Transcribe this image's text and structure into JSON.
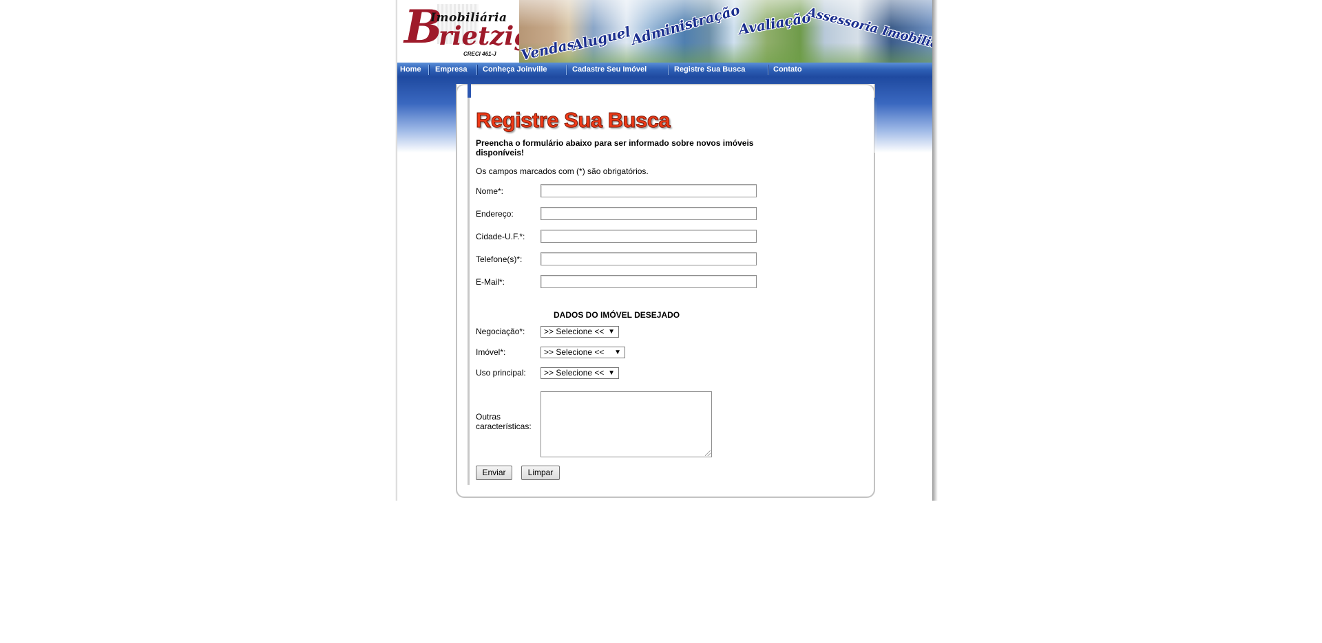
{
  "header": {
    "logo": {
      "letter": "B",
      "brand_top": "Imobiliária",
      "brand_name": "rietzig",
      "creci": "CRECI 461-J"
    },
    "banner_words": [
      "Vendas",
      "Aluguel",
      "Administração",
      "Avaliação",
      "Assessoria Imobiliária"
    ]
  },
  "nav": {
    "items": [
      {
        "label": "Home"
      },
      {
        "label": "Empresa"
      },
      {
        "label": "Conheça Joinville"
      },
      {
        "label": "Cadastre Seu Imóvel"
      },
      {
        "label": "Registre Sua Busca"
      },
      {
        "label": "Contato"
      }
    ]
  },
  "form": {
    "title": "Registre Sua Busca",
    "intro": "Preencha o formulário abaixo para ser informado sobre novos imóveis disponíveis!",
    "required_note": "Os campos marcados com (*) são obrigatórios.",
    "fields": [
      {
        "label": "Nome*:",
        "value": ""
      },
      {
        "label": "Endereço:",
        "value": ""
      },
      {
        "label": "Cidade-U.F.*:",
        "value": ""
      },
      {
        "label": "Telefone(s)*:",
        "value": ""
      },
      {
        "label": "E-Mail*:",
        "value": ""
      }
    ],
    "section_title": "DADOS DO IMÓVEL DESEJADO",
    "selects": [
      {
        "label": "Negociação*:",
        "selected": ">> Selecione <<"
      },
      {
        "label": "Imóvel*:",
        "selected": ">> Selecione <<"
      },
      {
        "label": "Uso principal:",
        "selected": ">> Selecione <<"
      }
    ],
    "textarea": {
      "label_line1": "Outras",
      "label_line2": "características:",
      "value": ""
    },
    "buttons": {
      "submit": "Enviar",
      "reset": "Limpar"
    }
  },
  "colors": {
    "brand_red": "#9e1a2a",
    "nav_blue": "#2d5fb5",
    "title_red": "#ef3a17"
  },
  "icons": {
    "select_arrow": "chevron-down-icon",
    "resize_grip": "resize-grip-icon"
  }
}
